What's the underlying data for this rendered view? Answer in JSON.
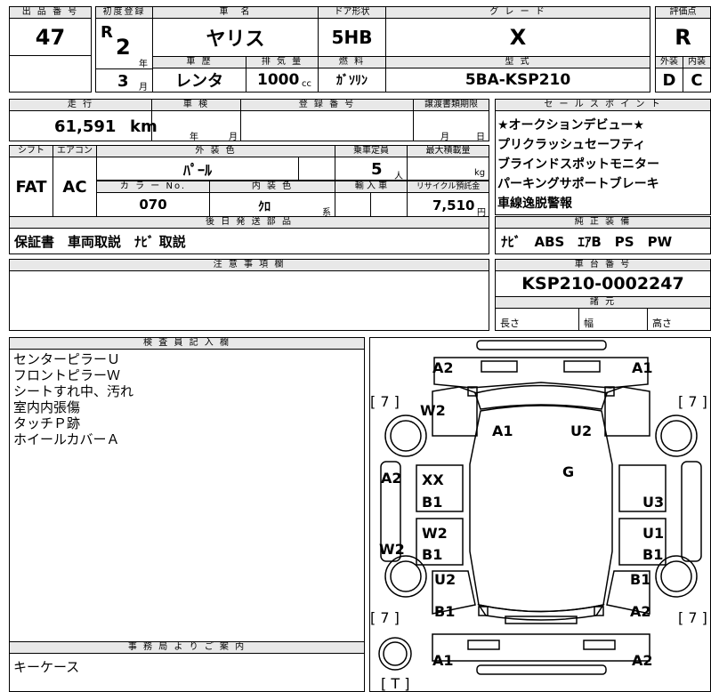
{
  "header": {
    "lot_no_label": "出 品 番 号",
    "lot_no": "47",
    "first_reg_label": "初度登録",
    "era": "R",
    "year": "2",
    "year_unit": "年",
    "month": "3",
    "month_unit": "月",
    "car_name_label": "車　名",
    "car_name": "ヤリス",
    "door_label": "ドア形状",
    "door": "5HB",
    "grade_label": "グ レ ー ド",
    "grade": "X",
    "score_label": "評価点",
    "score": "R",
    "history_label": "車 歴",
    "history": "レンタ",
    "displacement_label": "排 気 量",
    "displacement": "1000",
    "displacement_unit": "cc",
    "fuel_label": "燃 料",
    "fuel": "ｶﾞｿﾘﾝ",
    "model_label": "型 式",
    "model": "5BA-KSP210",
    "ext_label": "外装",
    "ext": "D",
    "int_label": "内装",
    "int": "C"
  },
  "specs": {
    "mileage_label": "走 行",
    "mileage": "61,591",
    "mileage_unit": "km",
    "inspection_label": "車 検",
    "inspection_year": "年",
    "inspection_month": "月",
    "reg_no_label": "登 録 番 号",
    "transfer_label": "譲渡書類期限",
    "transfer_month": "月",
    "transfer_day": "日",
    "shift_label": "シフト",
    "shift": "FAT",
    "ac_label": "エアコン",
    "ac": "AC",
    "ext_color_label": "外 装 色",
    "ext_color": "ﾊﾟｰﾙ",
    "seats_label": "乗車定員",
    "seats": "5",
    "seats_unit": "人",
    "load_label": "最大積載量",
    "load_unit": "kg",
    "color_no_label": "カ ラ ー No.",
    "color_no": "070",
    "int_color_label": "内 装 色",
    "int_color": "ｸﾛ",
    "int_color_unit": "系",
    "import_label": "輸 入 車",
    "recycle_label": "リサイクル預託金",
    "recycle": "7,510",
    "recycle_unit": "円",
    "later_label": "後 日 発 送 部 品",
    "later": "保証書　車両取説　ﾅﾋﾞ 取説"
  },
  "sales": {
    "label": "セ ー ル ス ポ イ ン ト",
    "points": [
      "★オークションデビュー★",
      "プリクラッシュセーフティ",
      "ブラインドスポットモニター",
      "パーキングサポートブレーキ",
      "車線逸脱警報"
    ],
    "equip_label": "純 正 装 備",
    "equip": "ﾅﾋﾞ　ABS　ｴｱB　PS　PW"
  },
  "notes": {
    "caution_label": "注 意 事 項 欄",
    "chassis_label": "車 台 番 号",
    "chassis": "KSP210-0002247",
    "dims_label": "諸 元",
    "length_label": "長さ",
    "width_label": "幅",
    "height_label": "高さ"
  },
  "inspector": {
    "label": "検 査 員 記 入 欄",
    "lines": [
      "センターピラーＵ",
      "フロントピラーＷ",
      "シートすれ中、汚れ",
      "室内内張傷",
      "タッチＰ跡",
      "ホイールカバーＡ"
    ]
  },
  "office": {
    "label": "事 務 局 よ り ご 案 内",
    "text": "キーケース"
  },
  "diagram": {
    "front_left": "A2",
    "front_right": "A1",
    "bracket_tl": "[ 7 ]",
    "bracket_tr": "[ 7 ]",
    "w2_top": "W2",
    "hood_a1": "A1",
    "hood_u2": "U2",
    "roof_g": "G",
    "left_a2": "A2",
    "xx": "XX",
    "b1_a": "B1",
    "u3": "U3",
    "w2_door": "W2",
    "w2_side": "W2",
    "b1_b": "B1",
    "u1": "U1",
    "b1_c": "B1",
    "u2_rear": "U2",
    "b1_rr": "B1",
    "b1_d": "B1",
    "a2_rr": "A2",
    "bracket_bl": "[ 7 ]",
    "bracket_br": "[ 7 ]",
    "rear_a1": "A1",
    "rear_a2": "A2",
    "spare_t": "[ T ]"
  }
}
